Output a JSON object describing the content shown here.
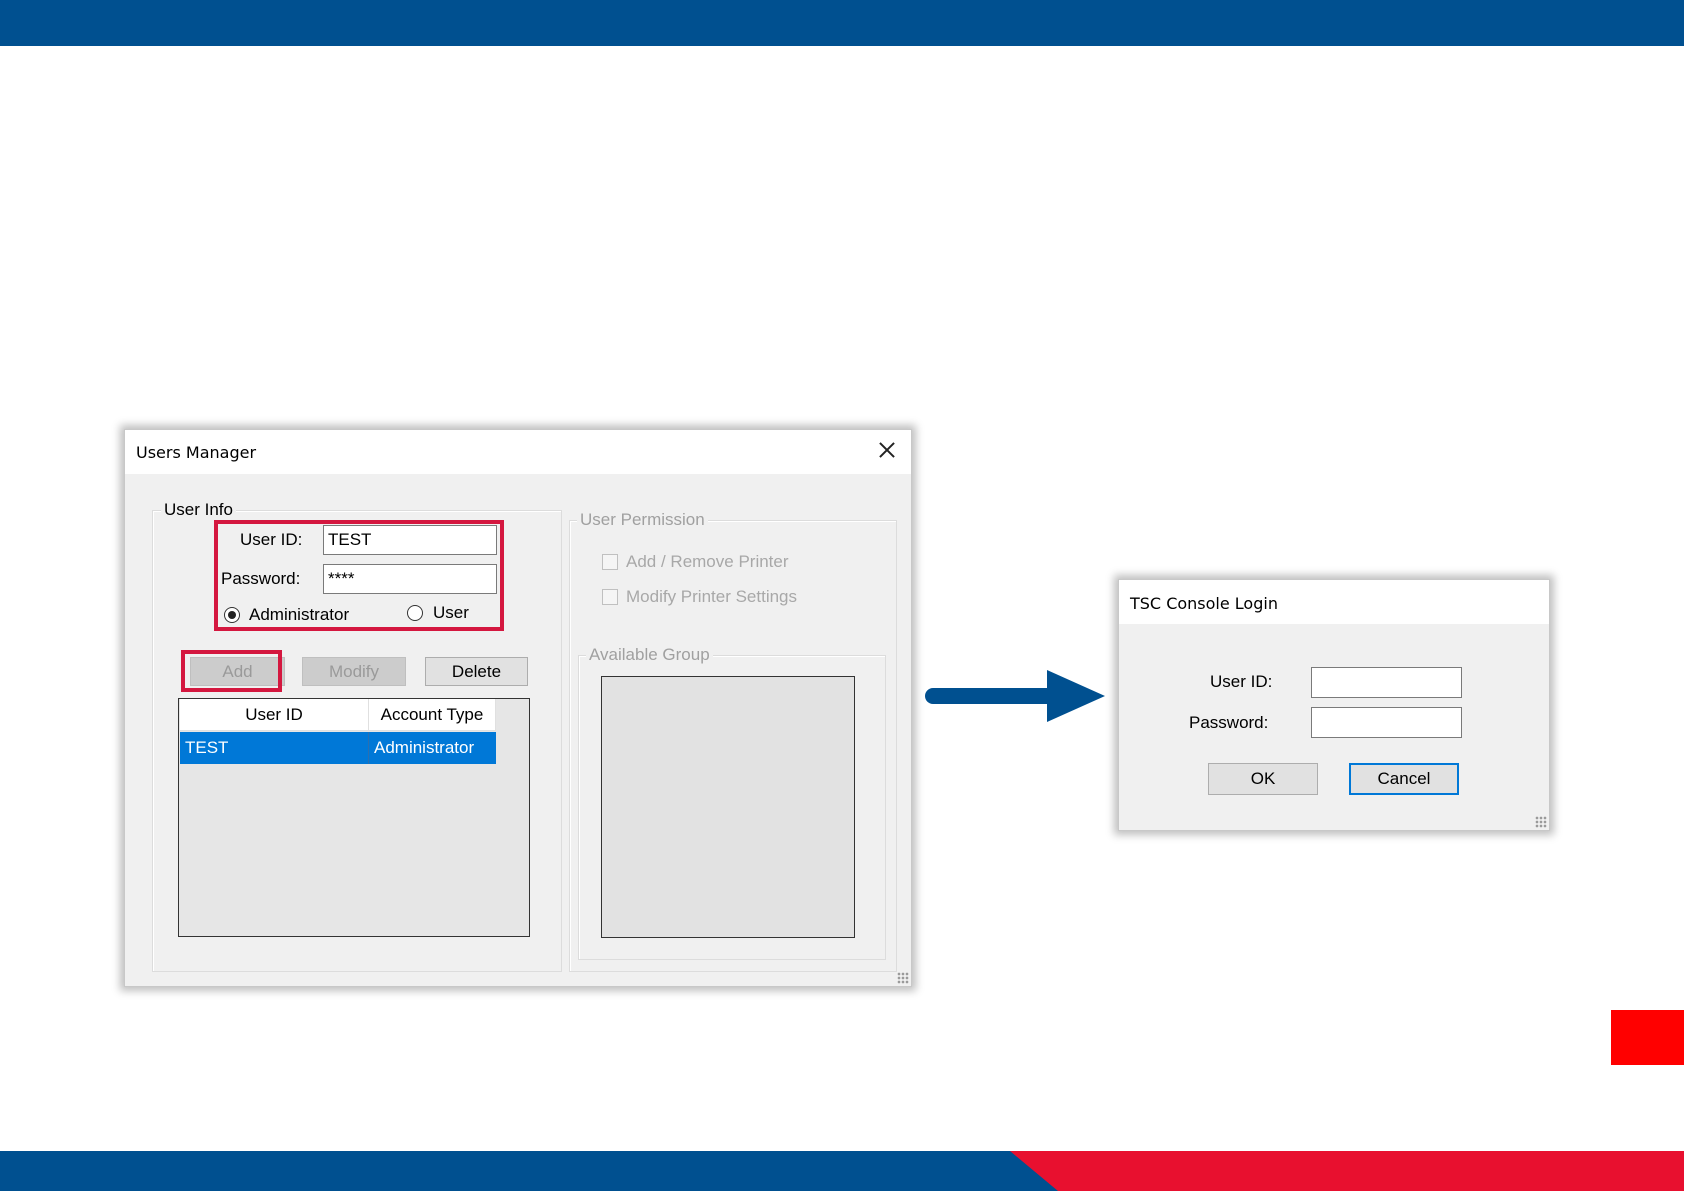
{
  "colors": {
    "brand_blue": "#005090",
    "brand_red": "#e8102f",
    "highlight": "#d4173f",
    "selection": "#0078d7"
  },
  "users_manager": {
    "title": "Users Manager",
    "user_info": {
      "label": "User Info",
      "user_id_label": "User ID:",
      "user_id_value": "TEST",
      "password_label": "Password:",
      "password_value": "****",
      "radio_admin": "Administrator",
      "radio_user": "User",
      "selected_type": "Administrator"
    },
    "buttons": {
      "add": "Add",
      "modify": "Modify",
      "delete": "Delete"
    },
    "table": {
      "columns": [
        "User ID",
        "Account Type"
      ],
      "rows": [
        {
          "user_id": "TEST",
          "account_type": "Administrator"
        }
      ]
    },
    "permission": {
      "label": "User Permission",
      "add_remove_printer": "Add / Remove Printer",
      "modify_printer_settings": "Modify Printer Settings"
    },
    "available_group": {
      "label": "Available Group"
    }
  },
  "login": {
    "title": "TSC Console Login",
    "user_id_label": "User ID:",
    "password_label": "Password:",
    "ok": "OK",
    "cancel": "Cancel"
  }
}
